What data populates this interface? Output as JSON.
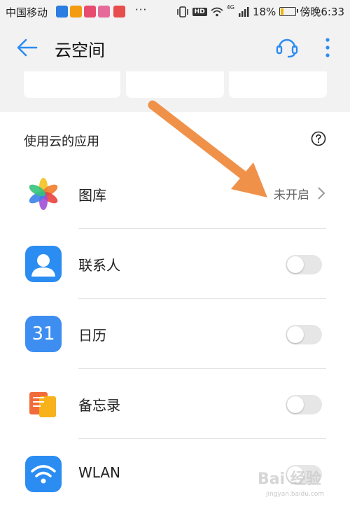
{
  "status_bar": {
    "carrier": "中国移动",
    "dots": "···",
    "network": "4G",
    "battery": "18%",
    "battery_level": 0.18,
    "time": "傍晚6:33",
    "hd": "HD"
  },
  "app_bar": {
    "title": "云空间"
  },
  "section": {
    "title": "使用云的应用"
  },
  "apps": [
    {
      "name": "图库",
      "state": "未开启",
      "control": "link"
    },
    {
      "name": "联系人",
      "control": "toggle",
      "enabled": false
    },
    {
      "name": "日历",
      "control": "toggle",
      "enabled": false,
      "icon_text": "31"
    },
    {
      "name": "备忘录",
      "control": "toggle",
      "enabled": false
    },
    {
      "name": "WLAN",
      "control": "toggle",
      "enabled": false
    }
  ],
  "colors": {
    "accent": "#2b8cf2",
    "arrow": "#f0914a",
    "background": "#f2f2f2"
  },
  "watermark": {
    "brand": "Bai 经验",
    "url": "jingyan.baidu.com"
  }
}
